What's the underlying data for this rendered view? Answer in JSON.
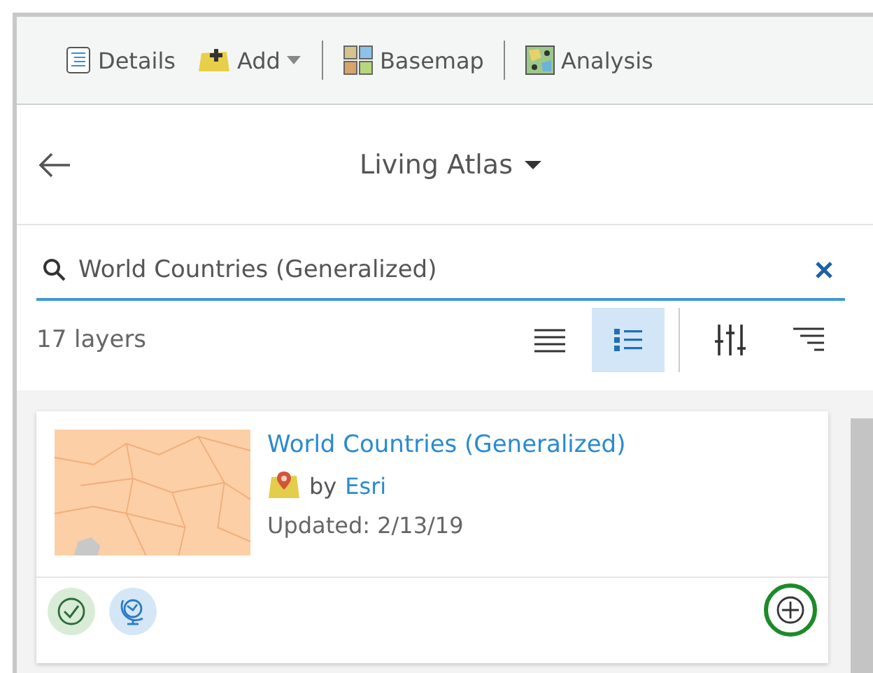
{
  "toolbar": {
    "items": [
      {
        "kind": "details",
        "label": "Details",
        "dropdown": false
      },
      {
        "kind": "add",
        "label": "Add",
        "dropdown": true
      },
      {
        "kind": "basemap",
        "label": "Basemap",
        "dropdown": false
      },
      {
        "kind": "analysis",
        "label": "Analysis",
        "dropdown": false
      }
    ]
  },
  "header": {
    "title": "Living Atlas"
  },
  "search": {
    "value": "World Countries (Generalized)"
  },
  "results": {
    "count": "17 layers",
    "views": [
      {
        "kind": "compact",
        "selected": false
      },
      {
        "kind": "detailed",
        "selected": true
      }
    ]
  },
  "cards": [
    {
      "title": "World Countries (Generalized)",
      "by": "by",
      "owner": "Esri",
      "updated": "Updated: 2/13/19",
      "badges": [
        {
          "kind": "authoritative"
        },
        {
          "kind": "living-atlas"
        }
      ]
    }
  ]
}
